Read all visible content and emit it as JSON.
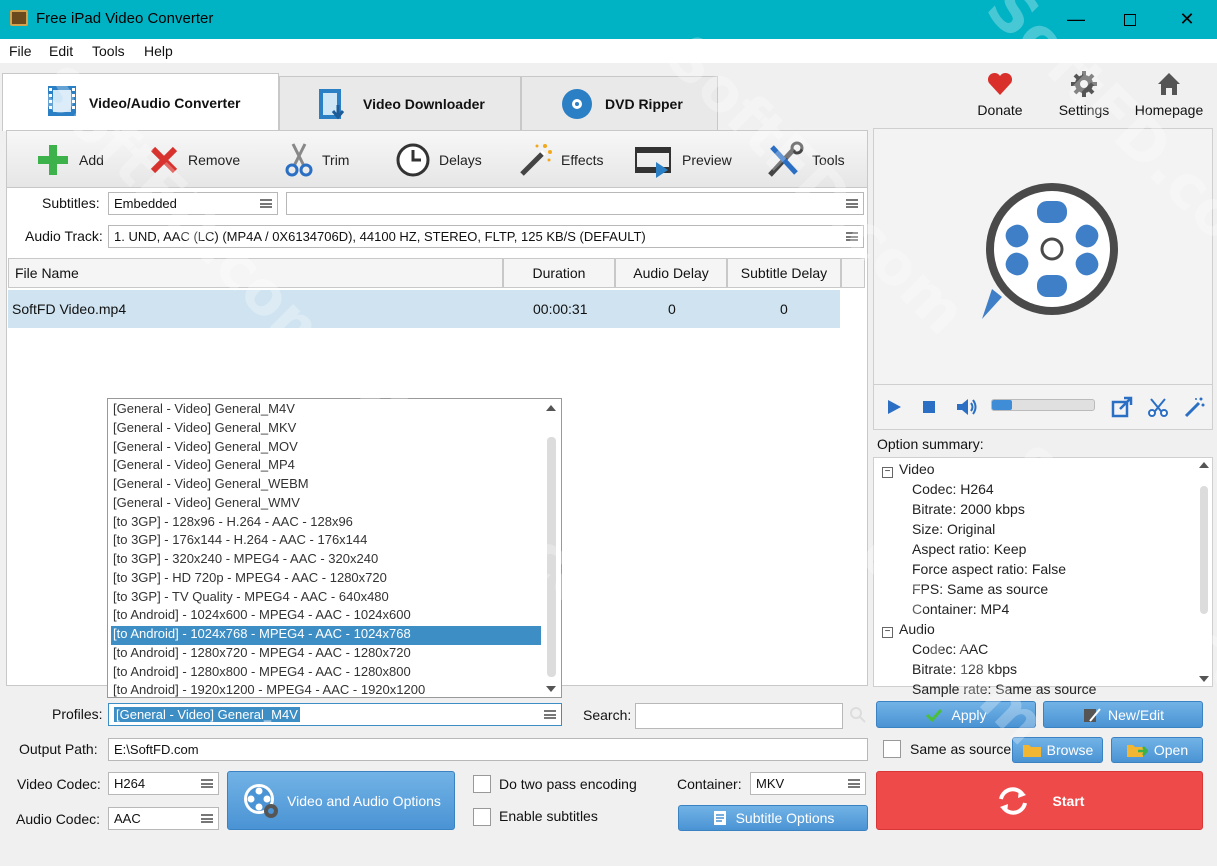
{
  "window": {
    "title": "Free iPad Video Converter"
  },
  "menu": [
    "File",
    "Edit",
    "Tools",
    "Help"
  ],
  "tabs": [
    {
      "label": "Video/Audio Converter",
      "active": true
    },
    {
      "label": "Video Downloader",
      "active": false
    },
    {
      "label": "DVD Ripper",
      "active": false
    }
  ],
  "top_links": {
    "donate": "Donate",
    "settings": "Settings",
    "homepage": "Homepage"
  },
  "toolbar": {
    "add": "Add",
    "remove": "Remove",
    "trim": "Trim",
    "delays": "Delays",
    "effects": "Effects",
    "preview": "Preview",
    "tools": "Tools"
  },
  "subtitles": {
    "label": "Subtitles:",
    "value": "Embedded",
    "secondary_value": ""
  },
  "audio_track": {
    "label": "Audio Track:",
    "value": "1. UND, AAC (LC) (MP4A / 0X6134706D), 44100 HZ, STEREO, FLTP, 125 KB/S (DEFAULT)"
  },
  "file_table": {
    "columns": [
      "File Name",
      "Duration",
      "Audio Delay",
      "Subtitle Delay"
    ],
    "rows": [
      {
        "file": "SoftFD Video.mp4",
        "duration": "00:00:31",
        "audio_delay": "0",
        "subtitle_delay": "0"
      }
    ]
  },
  "profile_list": [
    "[General - Video] General_M4V",
    "[General - Video] General_MKV",
    "[General - Video] General_MOV",
    "[General - Video] General_MP4",
    "[General - Video] General_WEBM",
    "[General - Video] General_WMV",
    "[to 3GP] - 128x96 - H.264 - AAC - 128x96",
    "[to 3GP] - 176x144 - H.264 - AAC - 176x144",
    "[to 3GP] - 320x240 - MPEG4 - AAC - 320x240",
    "[to 3GP] - HD 720p - MPEG4 - AAC - 1280x720",
    "[to 3GP] - TV Quality - MPEG4 - AAC - 640x480",
    "[to Android] - 1024x600 - MPEG4 - AAC - 1024x600",
    "[to Android] - 1024x768 - MPEG4 - AAC - 1024x768",
    "[to Android] - 1280x720 - MPEG4 - AAC - 1280x720",
    "[to Android] - 1280x800 - MPEG4 - AAC - 1280x800",
    "[to Android] - 1920x1200 - MPEG4 - AAC - 1920x1200"
  ],
  "profile_list_selected_index": 12,
  "profiles": {
    "label": "Profiles:",
    "value": "[General - Video] General_M4V"
  },
  "search": {
    "label": "Search:",
    "value": ""
  },
  "output_path": {
    "label": "Output Path:",
    "value": "E:\\SoftFD.com"
  },
  "video_codec": {
    "label": "Video Codec:",
    "value": "H264"
  },
  "audio_codec": {
    "label": "Audio Codec:",
    "value": "AAC"
  },
  "buttons": {
    "video_audio_options": "Video and Audio Options",
    "apply": "Apply",
    "new_edit": "New/Edit",
    "browse": "Browse",
    "open": "Open",
    "start": "Start",
    "subtitle_options": "Subtitle Options"
  },
  "checkboxes": {
    "two_pass": "Do two pass encoding",
    "enable_subtitles": "Enable subtitles",
    "same_as_source": "Same as source"
  },
  "container": {
    "label": "Container:",
    "value": "MKV"
  },
  "player": {
    "progress": 0.2
  },
  "option_summary": {
    "label": "Option summary:",
    "video_header": "Video",
    "video_items": [
      "Codec: H264",
      "Bitrate: 2000 kbps",
      "Size:  Original",
      "Aspect ratio: Keep",
      "Force aspect ratio: False",
      "FPS: Same as source",
      "Container: MP4"
    ],
    "audio_header": "Audio",
    "audio_items": [
      "Codec: AAC",
      "Bitrate: 128 kbps",
      "Sample rate: Same as source"
    ]
  },
  "watermark": "SoftFD.com",
  "colors": {
    "titlebar": "#00b3c4",
    "accent_blue": "#4a93d4",
    "start_red": "#ef4a4a",
    "selection": "#3d8ec5"
  }
}
